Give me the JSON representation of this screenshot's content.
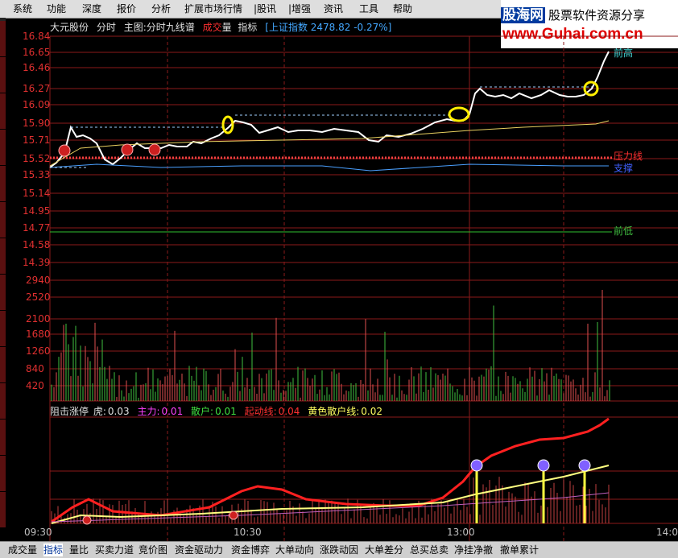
{
  "menu": [
    "系统",
    "功能",
    "深度",
    "报价",
    "分析",
    "扩展市场行情",
    "|股讯",
    "|增强",
    "资讯",
    "工具",
    "帮助"
  ],
  "logo": {
    "cn": "股海网",
    "tag": "股票软件资源分享",
    "url": "www.Guhai.com.cn"
  },
  "header": {
    "stock_name": "大元股份",
    "period": "分时",
    "main_chart": "主图:分时九线谱",
    "vol_label_1": "成交",
    "vol_label_2": "量",
    "indicator": "指标",
    "index_info": "[上证指数 2478.82 -0.27%]"
  },
  "price_axis": [
    "16.84",
    "16.65",
    "16.46",
    "16.27",
    "16.09",
    "15.90",
    "15.71",
    "15.52",
    "15.33",
    "15.14",
    "14.95",
    "14.77",
    "14.58",
    "14.39"
  ],
  "volume_axis": [
    "2940",
    "2520",
    "2100",
    "1680",
    "1260",
    "840",
    "420"
  ],
  "annotations": {
    "prev_high": "前高",
    "pressure": "压力线",
    "support": "支撑",
    "prev_low": "前低"
  },
  "indicator_line": {
    "name": "阻击涨停",
    "tiger_label": "虎:",
    "tiger_value": "0.03",
    "main_label": "主力:",
    "main_value": "0.01",
    "retail_label": "散户:",
    "retail_value": "0.01",
    "start_label": "起动线:",
    "start_value": "0.04",
    "yellow_label": "黄色散户线:",
    "yellow_value": "0.02"
  },
  "time_axis": [
    "09:30",
    "10:30",
    "13:00",
    "14:0"
  ],
  "bottom_tabs": [
    "成交量",
    "指标",
    "量比",
    "买卖力道",
    "竞价图",
    "资金驱动力",
    "资金博弈",
    "大单动向",
    "涨跌动因",
    "大单差分",
    "总买总卖",
    "净挂净撤",
    "撤单累计"
  ],
  "active_tab": "指标",
  "colors": {
    "grid": "#8b1a1a",
    "price_line": "#ffffff",
    "avg_line": "#e8d060",
    "vol_up": "#e05050",
    "vol_down": "#40c040",
    "main_force": "#ff2020",
    "retail": "#ffff80"
  }
}
